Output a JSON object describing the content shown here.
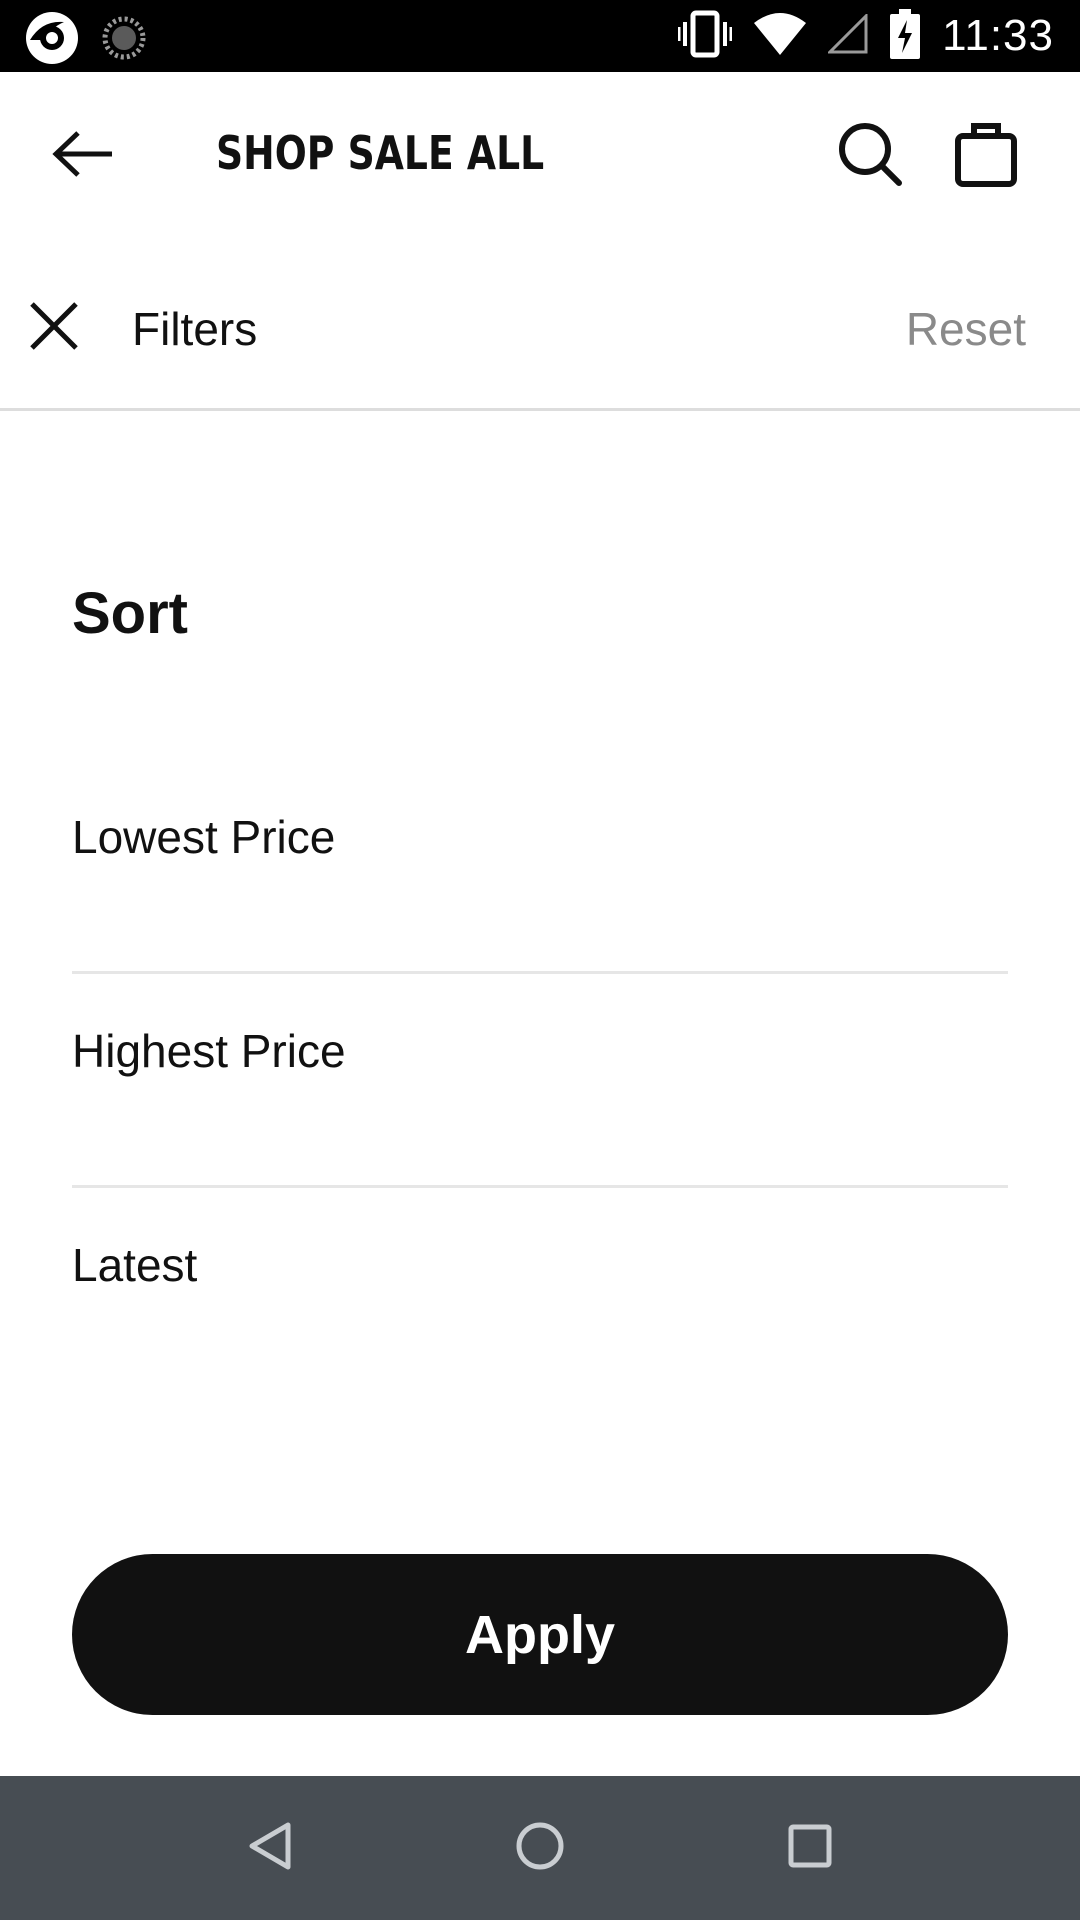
{
  "status_bar": {
    "time": "11:33",
    "icons": [
      "app-notification-icon",
      "loading-icon",
      "vibrate-icon",
      "wifi-icon",
      "signal-icon",
      "battery-charging-icon"
    ]
  },
  "header": {
    "title": "SHOP SALE ALL",
    "icons": [
      "back-arrow-icon",
      "search-icon",
      "shopping-bag-icon"
    ]
  },
  "filters": {
    "title": "Filters",
    "reset_label": "Reset",
    "close_icon": "close-icon"
  },
  "sort": {
    "heading": "Sort",
    "options": [
      {
        "label": "Lowest Price"
      },
      {
        "label": "Highest Price"
      },
      {
        "label": "Latest"
      }
    ]
  },
  "apply": {
    "label": "Apply"
  },
  "nav_bar": {
    "icons": [
      "back-triangle-icon",
      "home-circle-icon",
      "recents-square-icon"
    ]
  },
  "colors": {
    "status_bar_bg": "#000000",
    "primary_text": "#111111",
    "muted_text": "#8a8a8a",
    "apply_bg": "#111111",
    "nav_bar_bg": "#474d53",
    "divider": "#e6e6e6"
  }
}
